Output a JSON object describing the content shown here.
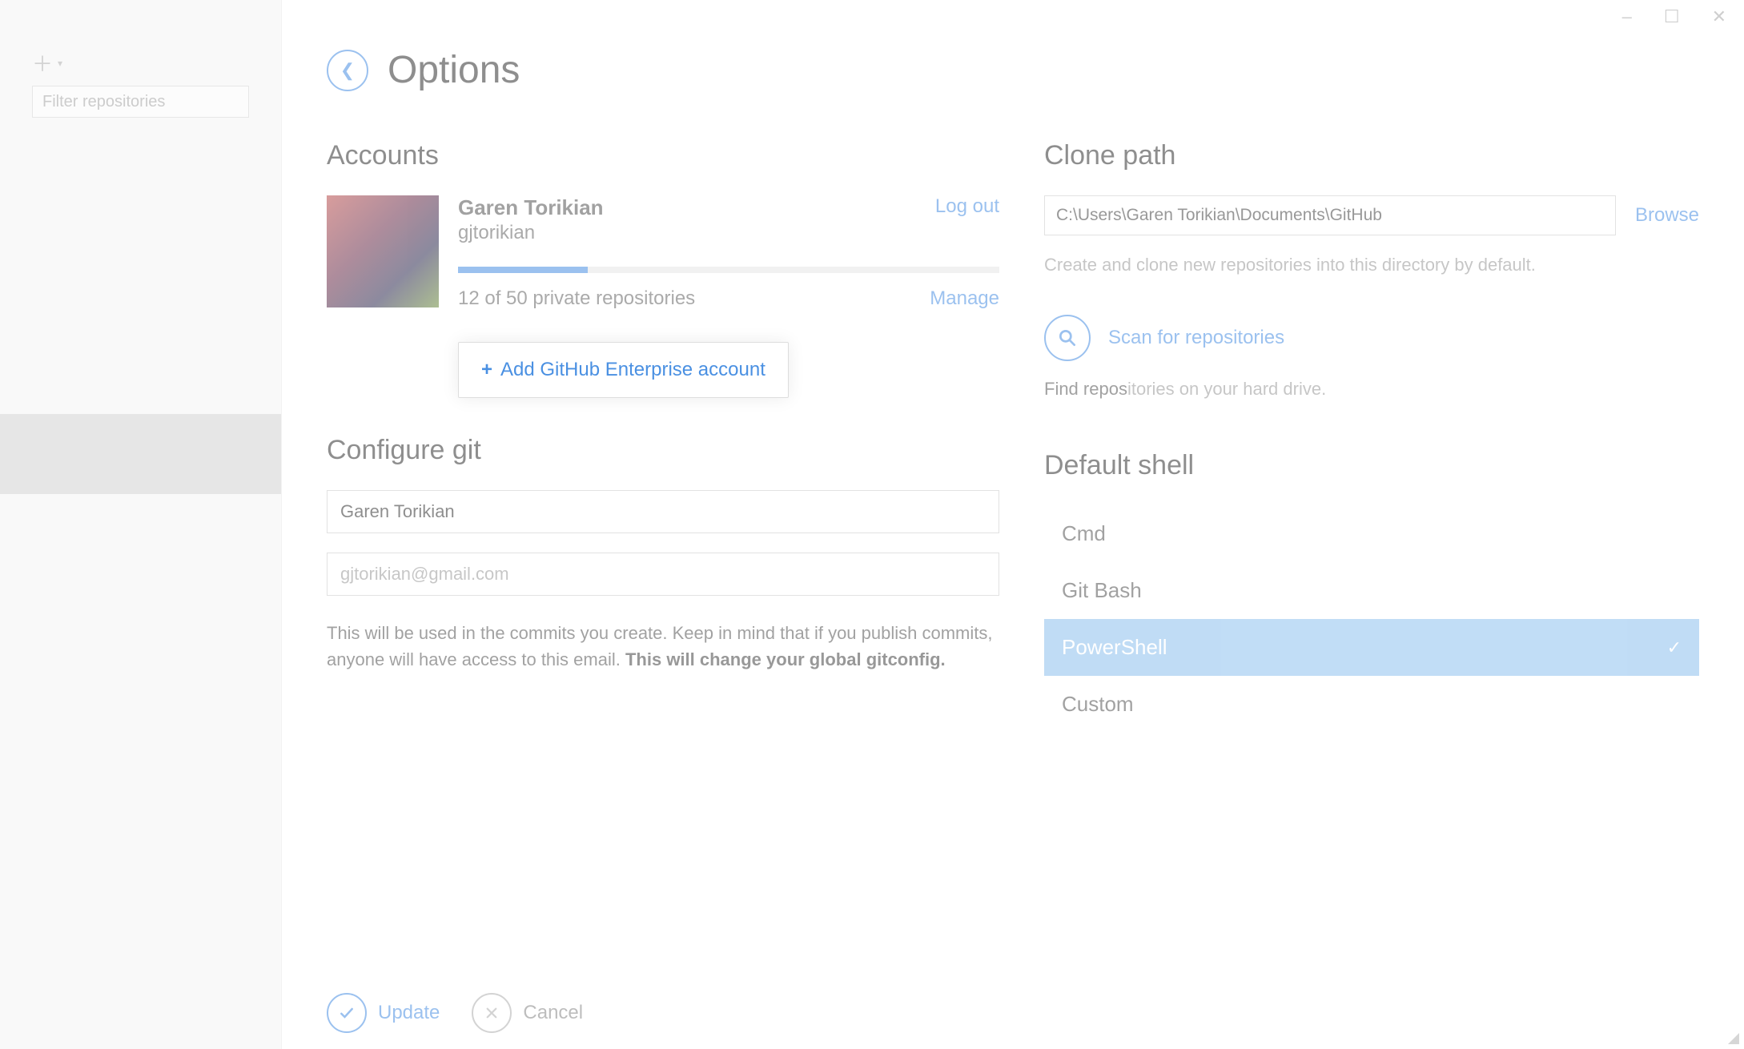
{
  "window": {
    "minimize": "–",
    "maximize": "☐",
    "close": "✕"
  },
  "sidebar": {
    "filter_placeholder": "Filter repositories"
  },
  "header": {
    "title": "Options"
  },
  "accounts": {
    "title": "Accounts",
    "name": "Garen Torikian",
    "username": "gjtorikian",
    "logout": "Log out",
    "repos_text": "12 of 50 private repositories",
    "manage": "Manage",
    "progress_percent": 24,
    "add_enterprise": "Add GitHub Enterprise account"
  },
  "configure_git": {
    "title": "Configure git",
    "name_value": "Garen Torikian",
    "email_value": "gjtorikian@gmail.com",
    "desc_1": "This will be used in the commits you create. Keep in mind that if you publish commits, anyone will have access to this email.",
    "desc_2": "This will change your global gitconfig."
  },
  "footer": {
    "update": "Update",
    "cancel": "Cancel"
  },
  "clone": {
    "title": "Clone path",
    "path": "C:\\Users\\Garen Torikian\\Documents\\GitHub",
    "browse": "Browse",
    "hint": "Create and clone new repositories into this directory by default.",
    "scan": "Scan for repositories",
    "drive_hint_dark": "Find repos",
    "drive_hint_light": "itories on your hard drive."
  },
  "shell": {
    "title": "Default shell",
    "items": [
      {
        "label": "Cmd",
        "selected": false
      },
      {
        "label": "Git Bash",
        "selected": false
      },
      {
        "label": "PowerShell",
        "selected": true
      },
      {
        "label": "Custom",
        "selected": false
      }
    ]
  }
}
